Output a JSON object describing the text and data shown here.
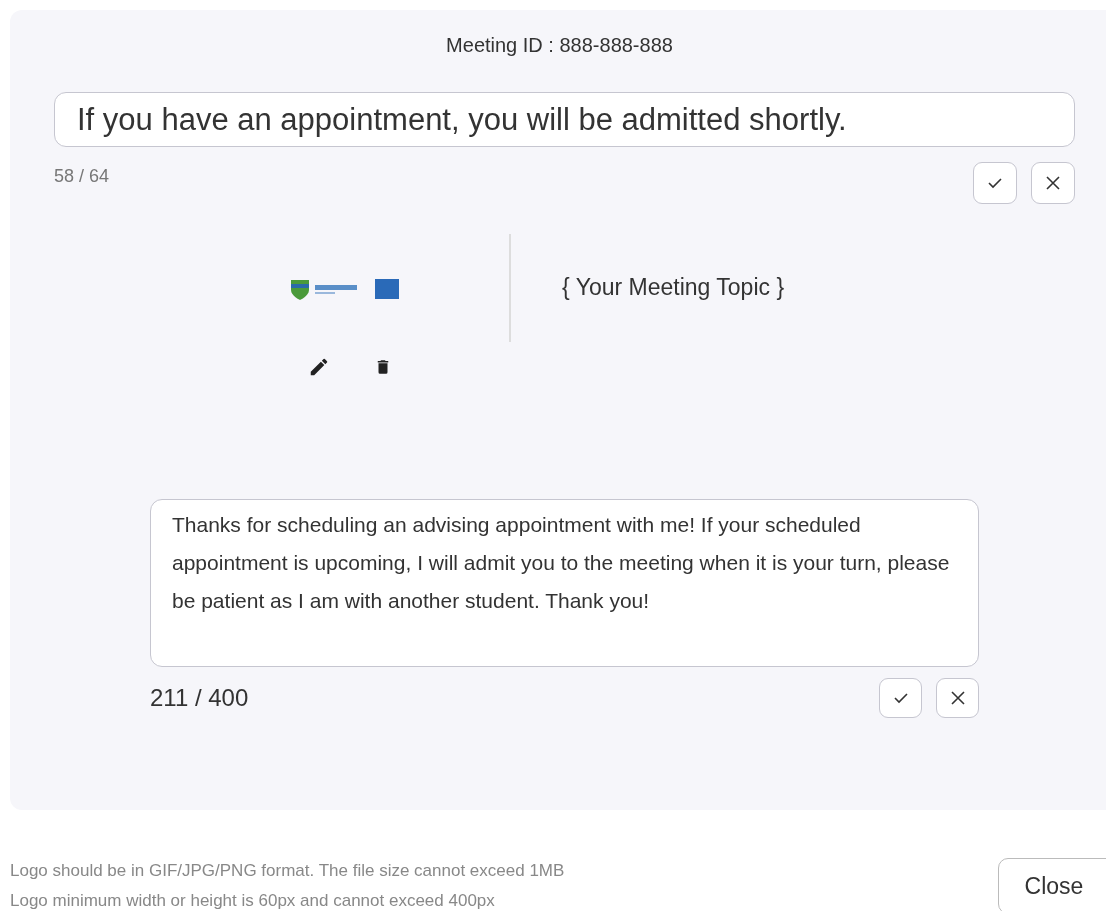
{
  "meeting_id": "Meeting ID : 888-888-888",
  "title_field": {
    "value": "If you have an appointment, you will be admitted shortly.",
    "counter": "58 / 64"
  },
  "topic": "{ Your Meeting Topic }",
  "message_field": {
    "value": "Thanks for scheduling an advising appointment with me! If your scheduled appointment is upcoming, I will admit you to the meeting when it is your turn, please be patient as I am with another student. Thank you!",
    "counter": "211 / 400"
  },
  "notes": [
    "Logo should be in GIF/JPG/PNG format. The file size cannot exceed 1MB",
    "Logo minimum width or height is 60px and cannot exceed 400px"
  ],
  "close_button": "Close"
}
